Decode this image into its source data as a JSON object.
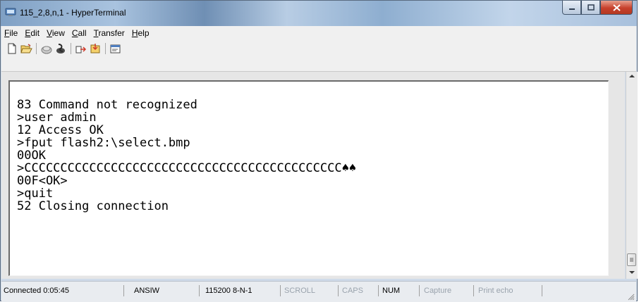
{
  "window": {
    "title": "115_2,8,n,1 - HyperTerminal"
  },
  "menu": [
    {
      "accel": "F",
      "rest": "ile"
    },
    {
      "accel": "E",
      "rest": "dit"
    },
    {
      "accel": "V",
      "rest": "iew"
    },
    {
      "accel": "C",
      "rest": "all"
    },
    {
      "accel": "T",
      "rest": "ransfer"
    },
    {
      "accel": "H",
      "rest": "elp"
    }
  ],
  "toolbar": {
    "icons": [
      "new-icon",
      "open-icon",
      "connect-icon",
      "disconnect-icon",
      "send-icon",
      "receive-icon",
      "properties-icon"
    ]
  },
  "terminal": {
    "lines": [
      "83 Command not recognized",
      ">user admin",
      "12 Access OK",
      ">fput flash2:\\select.bmp",
      "00OK",
      ">CCCCCCCCCCCCCCCCCCCCCCCCCCCCCCCCCCCCCCCCCCCC♠♠",
      "00F<OK>",
      ">quit",
      "52 Closing connection"
    ]
  },
  "status": {
    "connected": "Connected 0:05:45",
    "emulation": "ANSIW",
    "port": "115200 8-N-1",
    "scroll": "SCROLL",
    "caps": "CAPS",
    "num": "NUM",
    "capture": "Capture",
    "print_echo": "Print echo"
  },
  "colors": {
    "close_button": "#c7402b",
    "terminal_bg": "#ffffff",
    "window_chrome": "#cfdbe9"
  }
}
